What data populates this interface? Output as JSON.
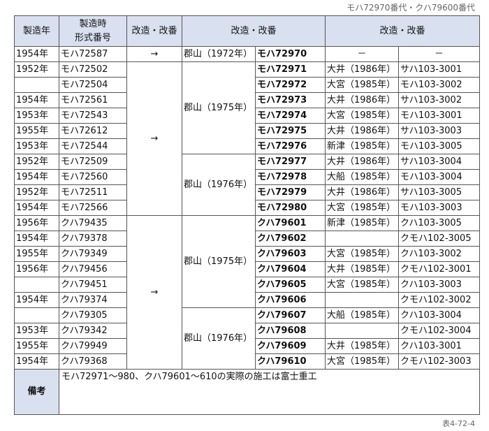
{
  "caption": "モハ72970番代・クハ79600番代",
  "footer": "表4-72-4",
  "headers": {
    "year": "製造年",
    "orig_line1": "製造時",
    "orig_line2": "形式番号",
    "mod1": "改造・改番",
    "mod2": "改造・改番",
    "mod3": "改造・改番"
  },
  "rows": [
    {
      "year": "1954年",
      "orig": "モハ72587",
      "arrow": "→",
      "place": "郡山（1972年）",
      "new": "モハ72970",
      "mod": "－",
      "final": "－"
    },
    {
      "year": "1952年",
      "orig": "モハ72502",
      "new": "モハ72971",
      "mod": "大井（1986年）",
      "final": "サハ103-3001"
    },
    {
      "year": "",
      "orig": "モハ72504",
      "new": "モハ72972",
      "mod": "大宮（1985年）",
      "final": "モハ103-3002"
    },
    {
      "year": "1954年",
      "orig": "モハ72561",
      "new": "モハ72973",
      "mod": "大井（1986年）",
      "final": "サハ103-3002"
    },
    {
      "year": "1953年",
      "orig": "モハ72543",
      "new": "モハ72974",
      "mod": "大宮（1985年）",
      "final": "モハ103-3001"
    },
    {
      "year": "1955年",
      "orig": "モハ72612",
      "new": "モハ72975",
      "mod": "大井（1986年）",
      "final": "サハ103-3003"
    },
    {
      "year": "1953年",
      "orig": "モハ72544",
      "new": "モハ72976",
      "mod": "新津（1985年）",
      "final": "モハ103-3005"
    },
    {
      "year": "1952年",
      "orig": "モハ72509",
      "new": "モハ72977",
      "mod": "大井（1986年）",
      "final": "サハ103-3004"
    },
    {
      "year": "1954年",
      "orig": "モハ72560",
      "new": "モハ72978",
      "mod": "大船（1985年）",
      "final": "モハ103-3004"
    },
    {
      "year": "1952年",
      "orig": "モハ72511",
      "new": "モハ72979",
      "mod": "大井（1986年）",
      "final": "サハ103-3005"
    },
    {
      "year": "1954年",
      "orig": "モハ72566",
      "new": "モハ72980",
      "mod": "大宮（1985年）",
      "final": "モハ103-3003"
    },
    {
      "year": "1956年",
      "orig": "クハ79435",
      "new": "クハ79601",
      "mod": "新津（1985年）",
      "final": "クハ103-3005"
    },
    {
      "year": "1954年",
      "orig": "クハ79378",
      "new": "クハ79602",
      "mod": "",
      "final": "クモハ102-3005"
    },
    {
      "year": "1955年",
      "orig": "クハ79349",
      "new": "クハ79603",
      "mod": "大宮（1985年）",
      "final": "クハ103-3002"
    },
    {
      "year": "1956年",
      "orig": "クハ79456",
      "new": "クハ79604",
      "mod": "大井（1985年）",
      "final": "クモハ102-3001"
    },
    {
      "year": "",
      "orig": "クハ79451",
      "new": "クハ79605",
      "mod": "大宮（1985年）",
      "final": "クハ103-3003"
    },
    {
      "year": "1954年",
      "orig": "クハ79374",
      "new": "クハ79606",
      "mod": "",
      "final": "クモハ102-3002"
    },
    {
      "year": "",
      "orig": "クハ79305",
      "new": "クハ79607",
      "mod": "大船（1985年）",
      "final": "クハ103-3004"
    },
    {
      "year": "1953年",
      "orig": "クハ79342",
      "new": "クハ79608",
      "mod": "",
      "final": "クモハ102-3004"
    },
    {
      "year": "1955年",
      "orig": "クハ79949",
      "new": "クハ79609",
      "mod": "大井（1985年）",
      "final": "クハ103-3001"
    },
    {
      "year": "1954年",
      "orig": "クハ79368",
      "new": "クハ79610",
      "mod": "大宮（1985年）",
      "final": "クモハ102-3003"
    }
  ],
  "merged": {
    "arrow_moha": "→",
    "arrow_kuha": "→",
    "place_moha_a": "郡山（1975年）",
    "place_moha_b": "郡山（1976年）",
    "place_kuha_a": "郡山（1975年）",
    "place_kuha_b": "郡山（1976年）"
  },
  "note": {
    "label": "備考",
    "text": "モハ72971～980、クハ79601～610の実際の施工は富士重工"
  }
}
